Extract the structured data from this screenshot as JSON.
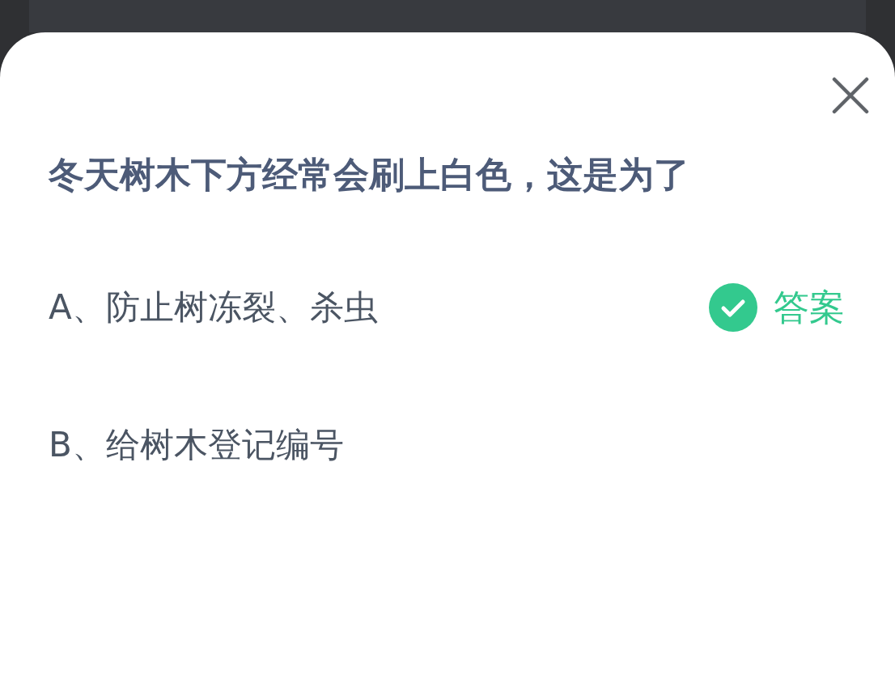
{
  "question": "冬天树木下方经常会刷上白色，这是为了",
  "options": [
    {
      "label": "A、防止树冻裂、杀虫",
      "correct": true
    },
    {
      "label": "B、给树木登记编号",
      "correct": false
    }
  ],
  "answer_label": "答案"
}
